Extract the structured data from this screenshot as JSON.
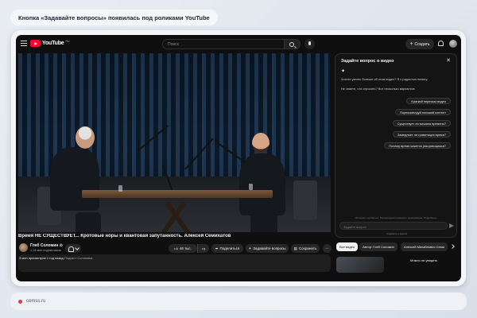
{
  "headline": "Кнопка «Задавайте вопросы» появилась под роликами YouTube",
  "youtube": {
    "logo_text": "YouTube",
    "logo_region": "RU",
    "search_placeholder": "Поиск",
    "create_label": "Создать",
    "create_icon": "plus-icon"
  },
  "video": {
    "title": "Время НЕ СУЩЕСТВУЕТ... Кротовые норы и квантовая запутанность. Алексей Семихатов",
    "channel_name": "Глеб Соломин",
    "channel_subs": "1,14 млн подписчиков",
    "likes": "46 тыс.",
    "share_label": "Поделиться",
    "ask_label": "Задавайте вопросы",
    "save_label": "Сохранить",
    "views": "3 млн просмотров",
    "published": "1 год назад",
    "hashtag": "Подкаст Соломина"
  },
  "ai_panel": {
    "title": "Задайте вопрос о видео",
    "intro": "Хотите узнать больше об этом видео? Я с радостью помогу.",
    "hint": "Не знаете, что спросить? Вот несколько вариантов",
    "suggestions": [
      "Краткий пересказ видео",
      "Порекомендуй похожий контент",
      "Существует ли машина времени?",
      "Замедляет ли гравитация время?",
      "Почему время кажется ускоряющимся?"
    ],
    "disclaimer": "ИИ может ошибаться. Рекомендуем проверять информацию. Подробнее…",
    "input_placeholder": "Задайте вопрос",
    "powered_by": "Спросите о Gemini"
  },
  "filters": [
    "Все видео",
    "Автор: Глеб Соломин",
    "Алексей Михайлович Семи"
  ],
  "recommendation_title": "Можно ли увидеть",
  "source": "comss.ru",
  "colors": {
    "accent_red": "#ff0033",
    "dark_bg": "#0f0f0f",
    "source_dot": "#e23a3a"
  }
}
